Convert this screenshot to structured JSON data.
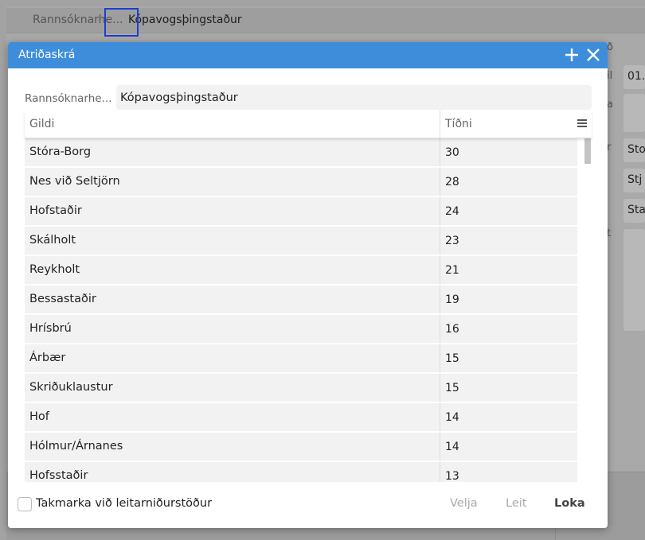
{
  "background": {
    "breadcrumb_label": "Rannsóknarhe...",
    "breadcrumb_value": "Kópavogsþingstaður",
    "right_fields": [
      "01.",
      "Sto",
      "Stj",
      "Sta"
    ],
    "right_labels": [
      "ð",
      "il",
      "a",
      "r",
      "t"
    ]
  },
  "dialog": {
    "title": "Atriðaskrá",
    "filter_label": "Rannsóknarhe...",
    "filter_value": "Kópavogsþingstaður",
    "columns": {
      "gildi": "Gildi",
      "tidni": "Tíðni"
    },
    "rows": [
      {
        "gildi": "Stóra-Borg",
        "tidni": "30"
      },
      {
        "gildi": "Nes við Seltjörn",
        "tidni": "28"
      },
      {
        "gildi": "Hofstaðir",
        "tidni": "24"
      },
      {
        "gildi": "Skálholt",
        "tidni": "23"
      },
      {
        "gildi": "Reykholt",
        "tidni": "21"
      },
      {
        "gildi": "Bessastaðir",
        "tidni": "19"
      },
      {
        "gildi": "Hrísbrú",
        "tidni": "16"
      },
      {
        "gildi": "Árbær",
        "tidni": "15"
      },
      {
        "gildi": "Skriðuklaustur",
        "tidni": "15"
      },
      {
        "gildi": "Hof",
        "tidni": "14"
      },
      {
        "gildi": "Hólmur/Árnanes",
        "tidni": "14"
      },
      {
        "gildi": "Hofsstaðir",
        "tidni": "13"
      }
    ],
    "restrict_label": "Takmarka við leitarniðurstöður",
    "buttons": {
      "velja": "Velja",
      "leit": "Leit",
      "loka": "Loka"
    }
  },
  "colors": {
    "title_bar": "#3e8ddb",
    "focus_outline": "#1b3fd0"
  }
}
